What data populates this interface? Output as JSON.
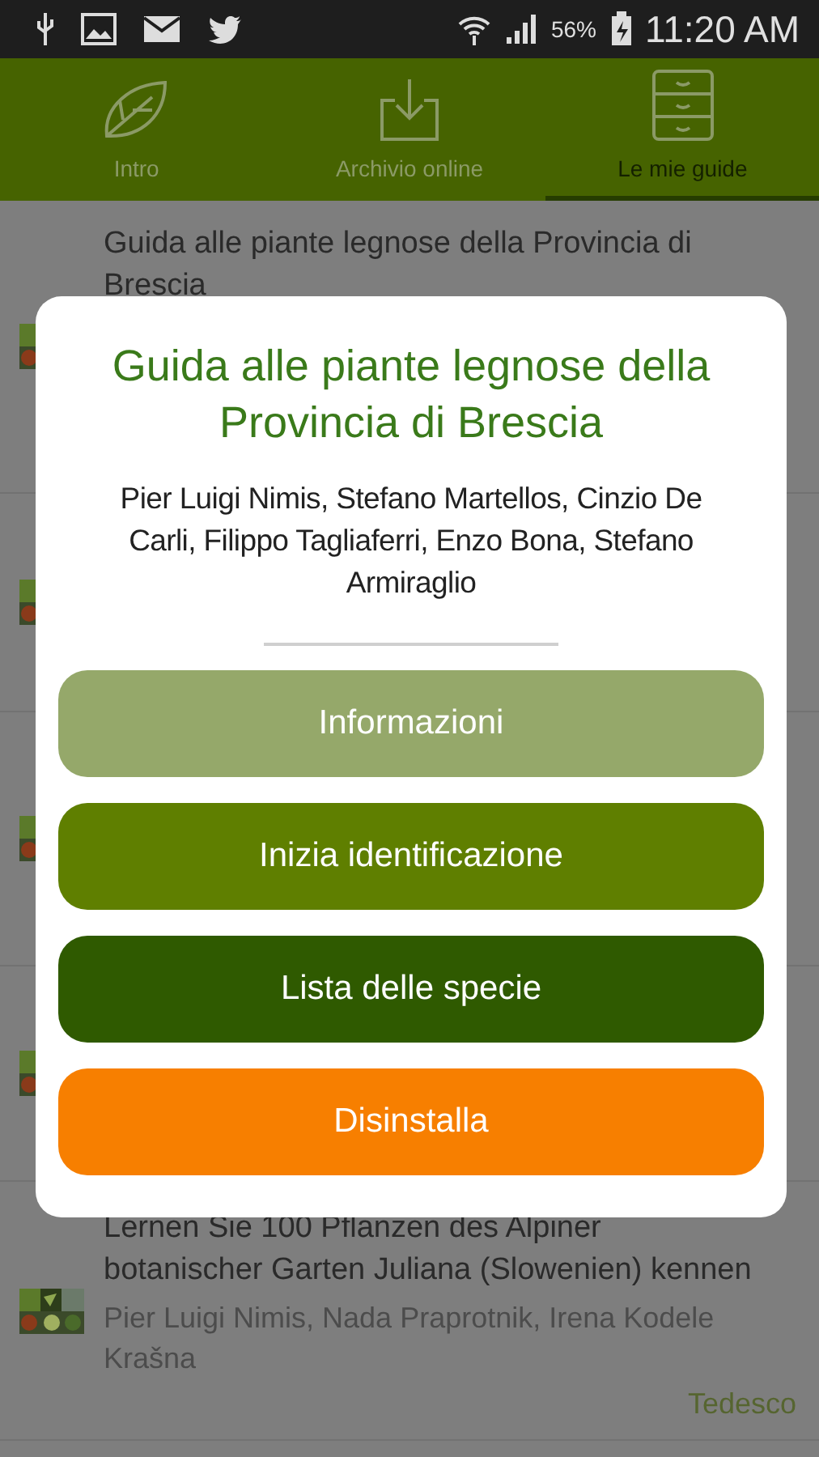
{
  "status_bar": {
    "battery": "56%",
    "time": "11:20 AM"
  },
  "tabs": [
    {
      "label": "Intro",
      "selected": false
    },
    {
      "label": "Archivio online",
      "selected": false
    },
    {
      "label": "Le mie guide",
      "selected": true
    }
  ],
  "guides": [
    {
      "title": "Guida alle piante legnose della Provincia di Brescia",
      "thumbnail": {
        "kind": "picture"
      }
    },
    {
      "thumbnail": {
        "kind": "picture"
      }
    },
    {
      "thumbnail": {
        "kind": "picture"
      }
    },
    {
      "thumbnail": {
        "kind": "picture"
      }
    },
    {
      "title": "Lernen Sie 100 Pflanzen  des Alpiner botanischer Garten Juliana (Slowenien) kennen",
      "authors": "Pier Luigi Nimis, Nada Praprotnik, Irena Kodele Krašna",
      "language": "Tedesco",
      "thumbnail": {
        "kind": "picture"
      }
    }
  ],
  "dialog": {
    "title": "Guida alle piante legnose della Provincia di Brescia",
    "authors": "Pier Luigi Nimis, Stefano Martellos, Cinzio De Carli, Filippo Tagliaferri, Enzo Bona, Stefano Armiraglio",
    "buttons": [
      {
        "label": "Informazioni",
        "color": "#95a86a"
      },
      {
        "label": "Inizia identificazione",
        "color": "#5f7f00"
      },
      {
        "label": "Lista delle specie",
        "color": "#2f5a00"
      },
      {
        "label": "Disinstalla",
        "color": "#f77f00"
      }
    ]
  }
}
